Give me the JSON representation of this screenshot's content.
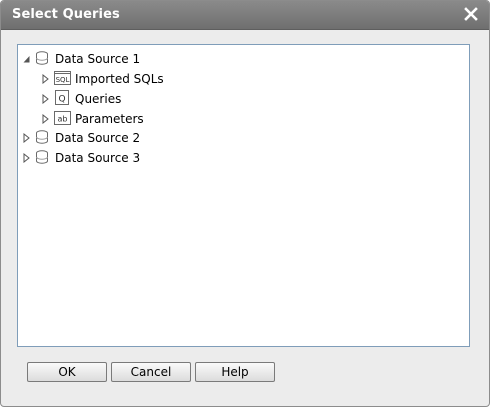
{
  "dialog": {
    "title": "Select Queries",
    "close_icon": "close-icon"
  },
  "tree": {
    "nodes": [
      {
        "label": "Data Source 1",
        "icon": "database-icon",
        "expanded": true
      },
      {
        "label": "Imported SQLs",
        "icon": "sql-icon",
        "expanded": false
      },
      {
        "label": "Queries",
        "icon": "query-icon",
        "expanded": false
      },
      {
        "label": "Parameters",
        "icon": "parameter-icon",
        "expanded": false
      },
      {
        "label": "Data Source 2",
        "icon": "database-icon",
        "expanded": false
      },
      {
        "label": "Data Source 3",
        "icon": "database-icon",
        "expanded": false
      }
    ]
  },
  "buttons": {
    "ok": "OK",
    "cancel": "Cancel",
    "help": "Help"
  },
  "colors": {
    "titlebar": "#7a7a7a",
    "dialog_bg": "#ececec",
    "panel_border": "#7f9db9"
  }
}
